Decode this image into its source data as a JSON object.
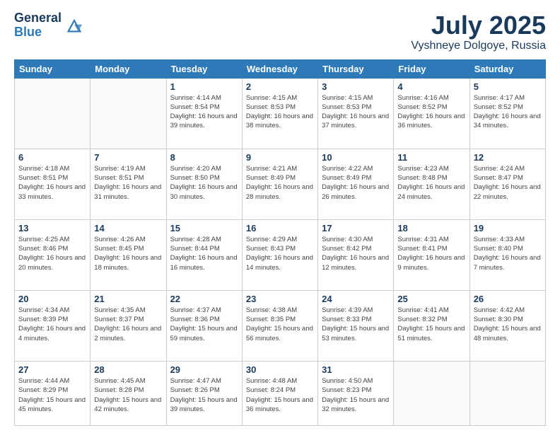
{
  "header": {
    "logo_line1": "General",
    "logo_line2": "Blue",
    "month": "July 2025",
    "location": "Vyshneye Dolgoye, Russia"
  },
  "weekdays": [
    "Sunday",
    "Monday",
    "Tuesday",
    "Wednesday",
    "Thursday",
    "Friday",
    "Saturday"
  ],
  "weeks": [
    [
      {
        "day": "",
        "sunrise": "",
        "sunset": "",
        "daylight": ""
      },
      {
        "day": "",
        "sunrise": "",
        "sunset": "",
        "daylight": ""
      },
      {
        "day": "1",
        "sunrise": "Sunrise: 4:14 AM",
        "sunset": "Sunset: 8:54 PM",
        "daylight": "Daylight: 16 hours and 39 minutes."
      },
      {
        "day": "2",
        "sunrise": "Sunrise: 4:15 AM",
        "sunset": "Sunset: 8:53 PM",
        "daylight": "Daylight: 16 hours and 38 minutes."
      },
      {
        "day": "3",
        "sunrise": "Sunrise: 4:15 AM",
        "sunset": "Sunset: 8:53 PM",
        "daylight": "Daylight: 16 hours and 37 minutes."
      },
      {
        "day": "4",
        "sunrise": "Sunrise: 4:16 AM",
        "sunset": "Sunset: 8:52 PM",
        "daylight": "Daylight: 16 hours and 36 minutes."
      },
      {
        "day": "5",
        "sunrise": "Sunrise: 4:17 AM",
        "sunset": "Sunset: 8:52 PM",
        "daylight": "Daylight: 16 hours and 34 minutes."
      }
    ],
    [
      {
        "day": "6",
        "sunrise": "Sunrise: 4:18 AM",
        "sunset": "Sunset: 8:51 PM",
        "daylight": "Daylight: 16 hours and 33 minutes."
      },
      {
        "day": "7",
        "sunrise": "Sunrise: 4:19 AM",
        "sunset": "Sunset: 8:51 PM",
        "daylight": "Daylight: 16 hours and 31 minutes."
      },
      {
        "day": "8",
        "sunrise": "Sunrise: 4:20 AM",
        "sunset": "Sunset: 8:50 PM",
        "daylight": "Daylight: 16 hours and 30 minutes."
      },
      {
        "day": "9",
        "sunrise": "Sunrise: 4:21 AM",
        "sunset": "Sunset: 8:49 PM",
        "daylight": "Daylight: 16 hours and 28 minutes."
      },
      {
        "day": "10",
        "sunrise": "Sunrise: 4:22 AM",
        "sunset": "Sunset: 8:49 PM",
        "daylight": "Daylight: 16 hours and 26 minutes."
      },
      {
        "day": "11",
        "sunrise": "Sunrise: 4:23 AM",
        "sunset": "Sunset: 8:48 PM",
        "daylight": "Daylight: 16 hours and 24 minutes."
      },
      {
        "day": "12",
        "sunrise": "Sunrise: 4:24 AM",
        "sunset": "Sunset: 8:47 PM",
        "daylight": "Daylight: 16 hours and 22 minutes."
      }
    ],
    [
      {
        "day": "13",
        "sunrise": "Sunrise: 4:25 AM",
        "sunset": "Sunset: 8:46 PM",
        "daylight": "Daylight: 16 hours and 20 minutes."
      },
      {
        "day": "14",
        "sunrise": "Sunrise: 4:26 AM",
        "sunset": "Sunset: 8:45 PM",
        "daylight": "Daylight: 16 hours and 18 minutes."
      },
      {
        "day": "15",
        "sunrise": "Sunrise: 4:28 AM",
        "sunset": "Sunset: 8:44 PM",
        "daylight": "Daylight: 16 hours and 16 minutes."
      },
      {
        "day": "16",
        "sunrise": "Sunrise: 4:29 AM",
        "sunset": "Sunset: 8:43 PM",
        "daylight": "Daylight: 16 hours and 14 minutes."
      },
      {
        "day": "17",
        "sunrise": "Sunrise: 4:30 AM",
        "sunset": "Sunset: 8:42 PM",
        "daylight": "Daylight: 16 hours and 12 minutes."
      },
      {
        "day": "18",
        "sunrise": "Sunrise: 4:31 AM",
        "sunset": "Sunset: 8:41 PM",
        "daylight": "Daylight: 16 hours and 9 minutes."
      },
      {
        "day": "19",
        "sunrise": "Sunrise: 4:33 AM",
        "sunset": "Sunset: 8:40 PM",
        "daylight": "Daylight: 16 hours and 7 minutes."
      }
    ],
    [
      {
        "day": "20",
        "sunrise": "Sunrise: 4:34 AM",
        "sunset": "Sunset: 8:39 PM",
        "daylight": "Daylight: 16 hours and 4 minutes."
      },
      {
        "day": "21",
        "sunrise": "Sunrise: 4:35 AM",
        "sunset": "Sunset: 8:37 PM",
        "daylight": "Daylight: 16 hours and 2 minutes."
      },
      {
        "day": "22",
        "sunrise": "Sunrise: 4:37 AM",
        "sunset": "Sunset: 8:36 PM",
        "daylight": "Daylight: 15 hours and 59 minutes."
      },
      {
        "day": "23",
        "sunrise": "Sunrise: 4:38 AM",
        "sunset": "Sunset: 8:35 PM",
        "daylight": "Daylight: 15 hours and 56 minutes."
      },
      {
        "day": "24",
        "sunrise": "Sunrise: 4:39 AM",
        "sunset": "Sunset: 8:33 PM",
        "daylight": "Daylight: 15 hours and 53 minutes."
      },
      {
        "day": "25",
        "sunrise": "Sunrise: 4:41 AM",
        "sunset": "Sunset: 8:32 PM",
        "daylight": "Daylight: 15 hours and 51 minutes."
      },
      {
        "day": "26",
        "sunrise": "Sunrise: 4:42 AM",
        "sunset": "Sunset: 8:30 PM",
        "daylight": "Daylight: 15 hours and 48 minutes."
      }
    ],
    [
      {
        "day": "27",
        "sunrise": "Sunrise: 4:44 AM",
        "sunset": "Sunset: 8:29 PM",
        "daylight": "Daylight: 15 hours and 45 minutes."
      },
      {
        "day": "28",
        "sunrise": "Sunrise: 4:45 AM",
        "sunset": "Sunset: 8:28 PM",
        "daylight": "Daylight: 15 hours and 42 minutes."
      },
      {
        "day": "29",
        "sunrise": "Sunrise: 4:47 AM",
        "sunset": "Sunset: 8:26 PM",
        "daylight": "Daylight: 15 hours and 39 minutes."
      },
      {
        "day": "30",
        "sunrise": "Sunrise: 4:48 AM",
        "sunset": "Sunset: 8:24 PM",
        "daylight": "Daylight: 15 hours and 36 minutes."
      },
      {
        "day": "31",
        "sunrise": "Sunrise: 4:50 AM",
        "sunset": "Sunset: 8:23 PM",
        "daylight": "Daylight: 15 hours and 32 minutes."
      },
      {
        "day": "",
        "sunrise": "",
        "sunset": "",
        "daylight": ""
      },
      {
        "day": "",
        "sunrise": "",
        "sunset": "",
        "daylight": ""
      }
    ]
  ]
}
